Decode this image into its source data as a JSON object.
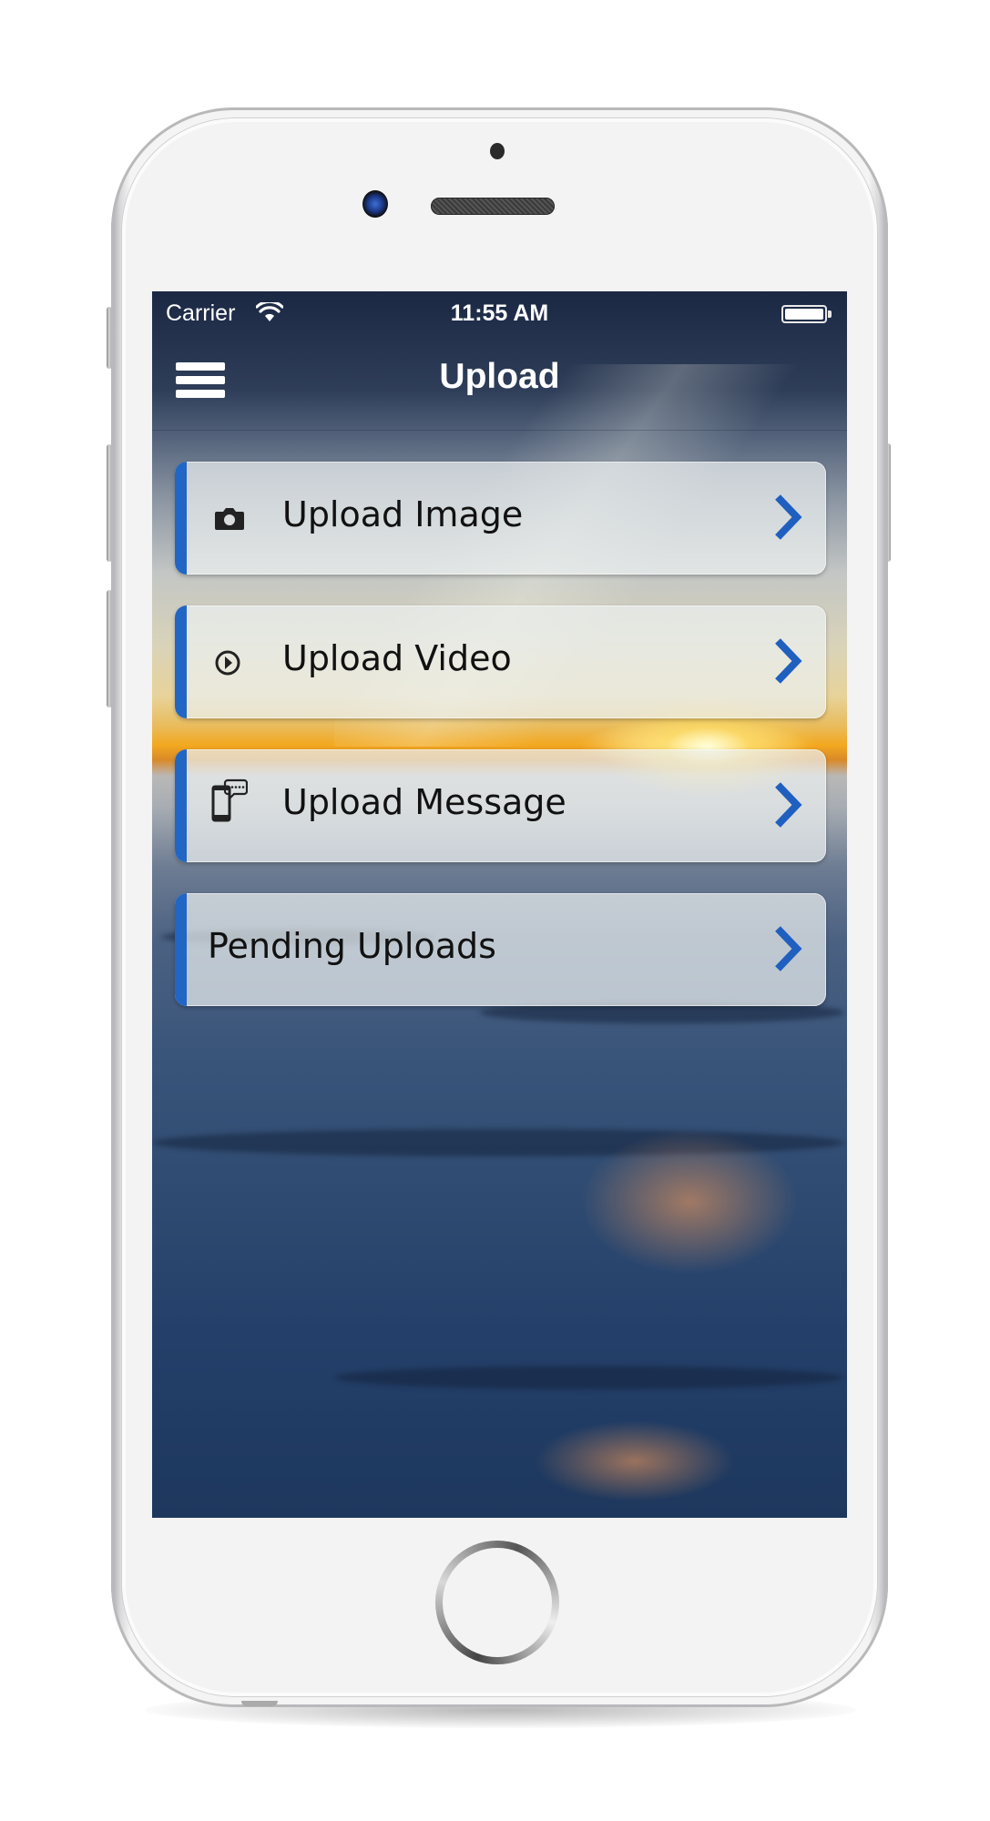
{
  "status_bar": {
    "carrier": "Carrier",
    "time": "11:55 AM",
    "wifi_icon": "wifi-icon",
    "battery_icon": "battery-full-icon",
    "battery_level": 1.0
  },
  "nav": {
    "title": "Upload",
    "menu_icon": "hamburger-menu-icon"
  },
  "menu_items": [
    {
      "label": "Upload Image",
      "icon": "camera-icon",
      "chevron": "chevron-right-icon"
    },
    {
      "label": "Upload Video",
      "icon": "play-circle-icon",
      "chevron": "chevron-right-icon"
    },
    {
      "label": "Upload Message",
      "icon": "phone-message-icon",
      "chevron": "chevron-right-icon"
    },
    {
      "label": "Pending Uploads",
      "icon": null,
      "chevron": "chevron-right-icon"
    }
  ],
  "colors": {
    "accent": "#2166c4",
    "chevron": "#1f5fbf",
    "nav_background": "#1c2a45",
    "text": "#111111"
  }
}
